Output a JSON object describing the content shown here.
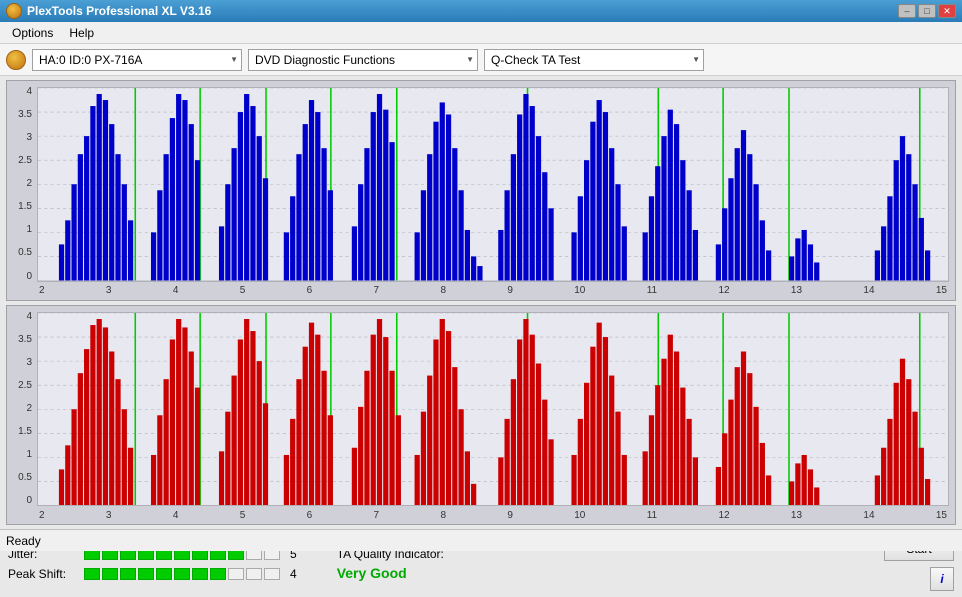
{
  "titleBar": {
    "title": "PlexTools Professional XL V3.16",
    "icon": "plextools-icon",
    "controls": {
      "minimize": "–",
      "maximize": "□",
      "close": "✕"
    }
  },
  "menuBar": {
    "items": [
      "Options",
      "Help"
    ]
  },
  "toolbar": {
    "driveLabel": "HA:0 ID:0 PX-716A",
    "functionLabel": "DVD Diagnostic Functions",
    "testLabel": "Q-Check TA Test"
  },
  "charts": {
    "topChart": {
      "color": "#0000cc",
      "yLabels": [
        "4",
        "3.5",
        "3",
        "2.5",
        "2",
        "1.5",
        "1",
        "0.5",
        "0"
      ],
      "xLabels": [
        "2",
        "3",
        "4",
        "5",
        "6",
        "7",
        "8",
        "9",
        "10",
        "11",
        "12",
        "13",
        "14",
        "15"
      ]
    },
    "bottomChart": {
      "color": "#cc0000",
      "yLabels": [
        "4",
        "3.5",
        "3",
        "2.5",
        "2",
        "1.5",
        "1",
        "0.5",
        "0"
      ],
      "xLabels": [
        "2",
        "3",
        "4",
        "5",
        "6",
        "7",
        "8",
        "9",
        "10",
        "11",
        "12",
        "13",
        "14",
        "15"
      ]
    }
  },
  "bottomPanel": {
    "jitterLabel": "Jitter:",
    "jitterValue": "5",
    "jitterBars": [
      true,
      true,
      true,
      true,
      true,
      true,
      true,
      true,
      true,
      false,
      false
    ],
    "peakShiftLabel": "Peak Shift:",
    "peakShiftValue": "4",
    "peakShiftBars": [
      true,
      true,
      true,
      true,
      true,
      true,
      true,
      true,
      false,
      false,
      false
    ],
    "taQualityLabel": "TA Quality Indicator:",
    "taQualityValue": "Very Good",
    "startButtonLabel": "Start",
    "infoButtonLabel": "i"
  },
  "statusBar": {
    "text": "Ready"
  }
}
